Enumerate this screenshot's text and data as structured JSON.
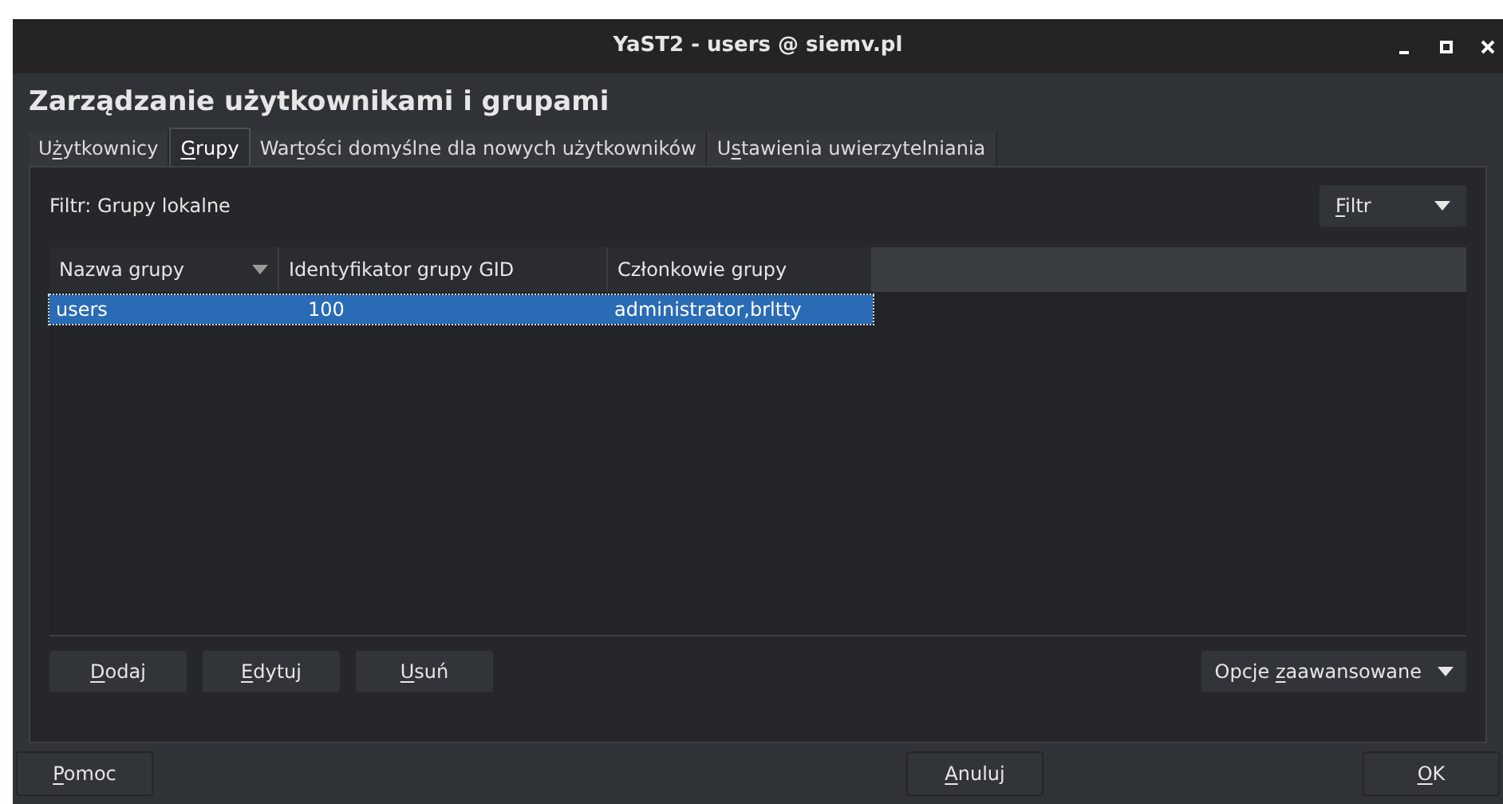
{
  "window": {
    "title": "YaST2 - users @ siemv.pl",
    "controls": [
      {
        "kind": "minimize"
      },
      {
        "kind": "maximize"
      },
      {
        "kind": "close"
      }
    ]
  },
  "heading": "Zarządzanie użytkownikami i grupami",
  "tabs": [
    {
      "label": {
        "before": "U",
        "key": "ż",
        "after": "ytkownicy"
      },
      "selected": false
    },
    {
      "label": {
        "key": "G",
        "after": "rupy"
      },
      "selected": true
    },
    {
      "label": {
        "before": "War",
        "key": "t",
        "after": "ości domyślne dla nowych użytkowników"
      },
      "selected": false
    },
    {
      "label": {
        "before": "U",
        "key": "s",
        "after": "tawienia uwierzytelniania"
      },
      "selected": false
    }
  ],
  "filter": {
    "label": "Filtr: Grupy lokalne",
    "button": {
      "label": {
        "key": "F",
        "after": "iltr"
      }
    }
  },
  "table": {
    "columns": [
      {
        "label": "Nazwa grupy",
        "sorted": true
      },
      {
        "label": "Identyfikator grupy GID",
        "sorted": false
      },
      {
        "label": "Członkowie grupy",
        "sorted": false
      }
    ],
    "rows": [
      {
        "cells": [
          "users",
          "100",
          "administrator,brltty"
        ],
        "selected": true
      }
    ]
  },
  "actions": [
    {
      "label": {
        "key": "D",
        "after": "odaj"
      }
    },
    {
      "label": {
        "key": "E",
        "after": "dytuj"
      }
    },
    {
      "label": {
        "key": "U",
        "after": "suń"
      }
    }
  ],
  "advanced": {
    "label": {
      "before": "Opcje ",
      "key": "z",
      "after": "aawansowane"
    }
  },
  "footer": [
    {
      "label": {
        "key": "P",
        "after": "omoc"
      }
    },
    {
      "label": {
        "key": "A",
        "after": "nuluj"
      }
    },
    {
      "label": {
        "key": "O",
        "after": "K"
      }
    }
  ]
}
